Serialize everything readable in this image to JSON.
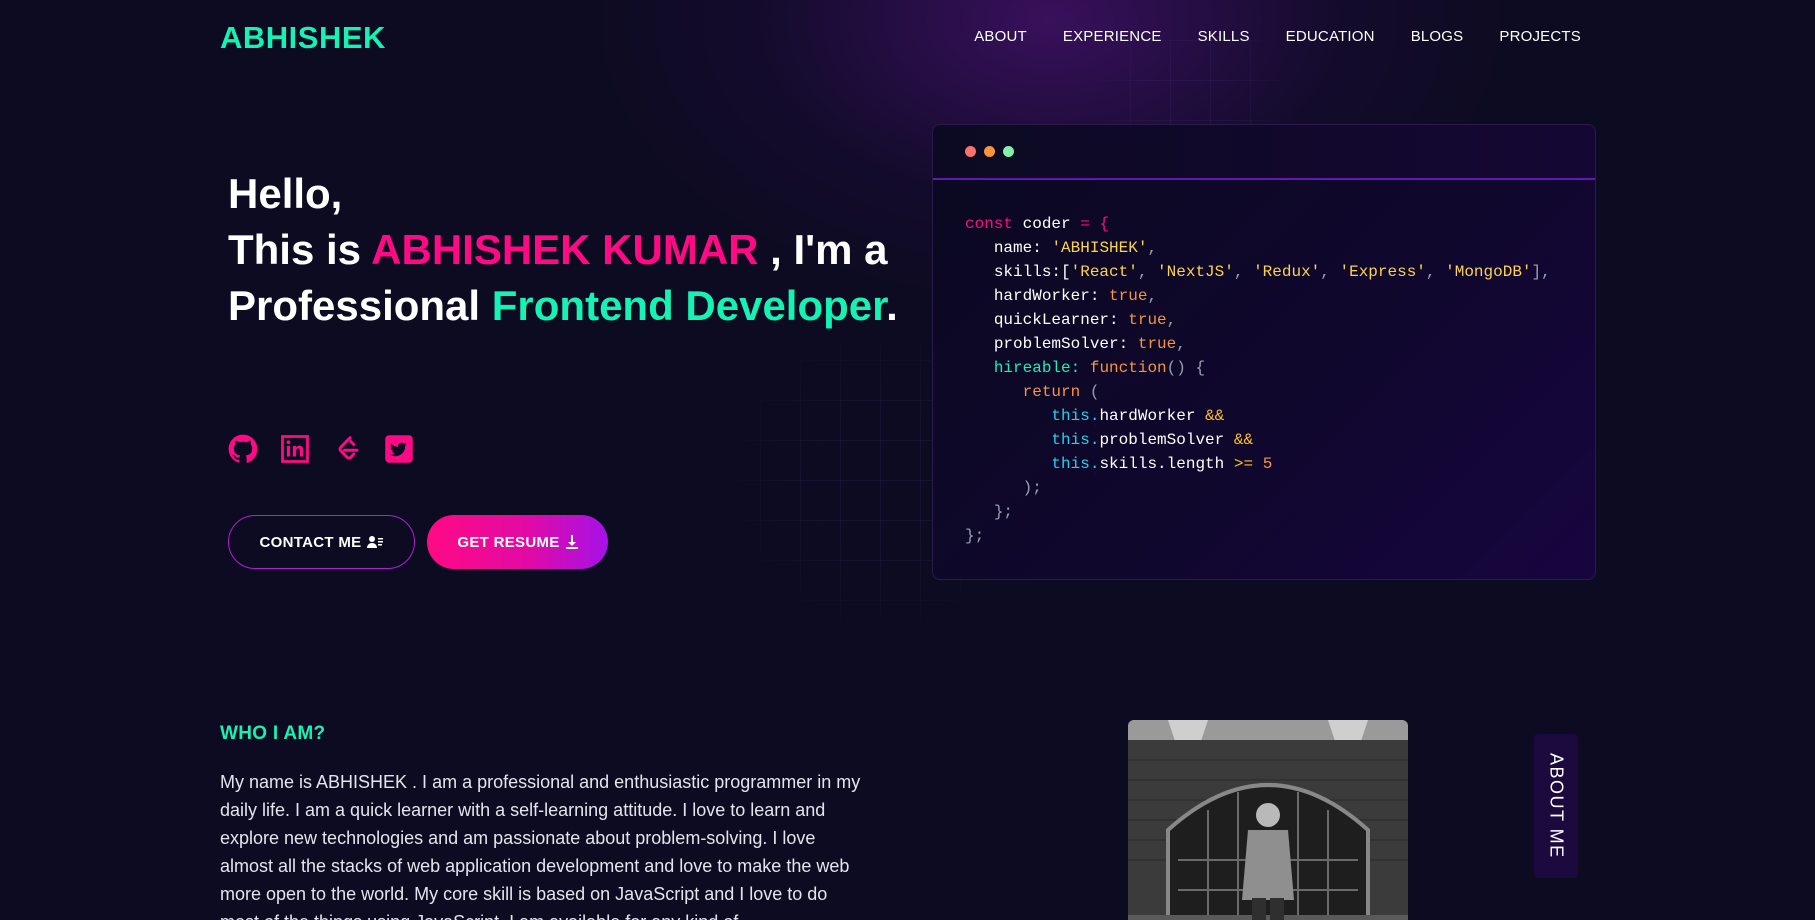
{
  "brand": {
    "logo": "ABHISHEK"
  },
  "nav": {
    "items": [
      {
        "label": "ABOUT"
      },
      {
        "label": "EXPERIENCE"
      },
      {
        "label": "SKILLS"
      },
      {
        "label": "EDUCATION"
      },
      {
        "label": "BLOGS"
      },
      {
        "label": "PROJECTS"
      }
    ]
  },
  "hero": {
    "greeting": "Hello,",
    "intro_prefix": "This is ",
    "name": "ABHISHEK KUMAR",
    "intro_suffix": " , I'm a",
    "role_prefix": "Professional ",
    "role": "Frontend Developer",
    "period": "."
  },
  "socials": [
    {
      "icon": "github-icon"
    },
    {
      "icon": "linkedin-icon"
    },
    {
      "icon": "leetcode-icon"
    },
    {
      "icon": "twitter-icon"
    }
  ],
  "buttons": {
    "contact": "CONTACT ME",
    "resume": "GET RESUME"
  },
  "code": {
    "dots": [
      "#f87171",
      "#fb923c",
      "#86efac"
    ],
    "kw_const": "const",
    "var": "coder",
    "eq_open": "= {",
    "name_key": "name:",
    "name_val": "'ABHISHEK'",
    "skills_key": "skills:[",
    "skills": [
      "'React'",
      "'NextJS'",
      "'Redux'",
      "'Express'",
      "'MongoDB'"
    ],
    "skills_close": "],",
    "hardworker_key": "hardWorker:",
    "quicklearner_key": "quickLearner:",
    "problemsolver_key": "problemSolver:",
    "true_val": "true",
    "hireable_key": "hireable:",
    "fn": "function",
    "fn_tail": "() {",
    "return_kw": "return",
    "return_open": "(",
    "this_kw": "this.",
    "hw_prop": "hardWorker",
    "ps_prop": "problemSolver",
    "sk_prop": "skills.length",
    "and_op": "&&",
    "gte_op": ">=",
    "num": "5",
    "ret_close": ");",
    "fn_close": "};",
    "obj_close": "};"
  },
  "about": {
    "heading": "WHO I AM?",
    "text": "My name is ABHISHEK . I am a professional and enthusiastic programmer in my daily life. I am a quick learner with a self-learning attitude. I love to learn and explore new technologies and am passionate about problem-solving. I love almost all the stacks of web application development and love to make the web more open to the world. My core skill is based on JavaScript and I love to do most of the things using JavaScript. I am available for any kind of",
    "tab_label": "ABOUT ME"
  },
  "colors": {
    "accent_green": "#16f2b3",
    "accent_pink": "#ff0a84",
    "background": "#0d0b21"
  }
}
